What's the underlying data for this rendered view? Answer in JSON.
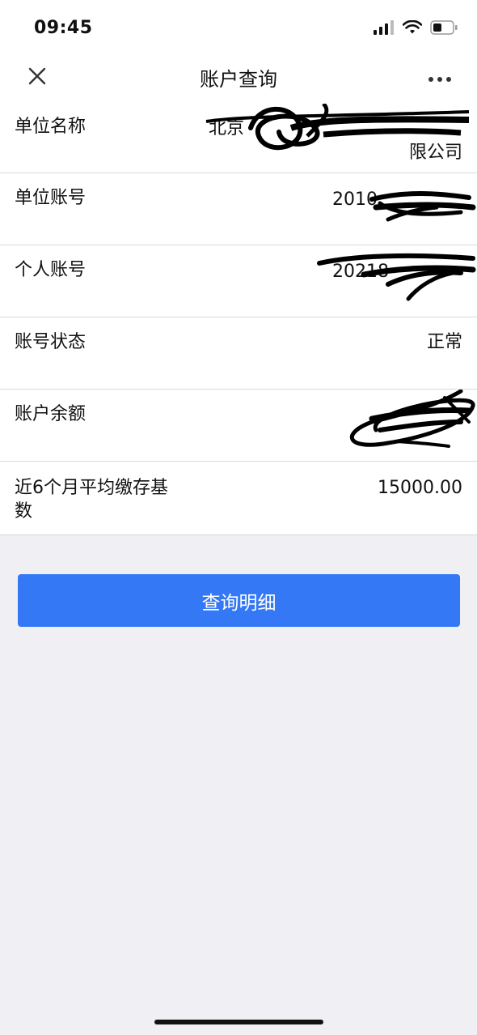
{
  "status_bar": {
    "time": "09:45"
  },
  "nav": {
    "title": "账户查询"
  },
  "rows": [
    {
      "label": "单位名称",
      "value_line1": "北京",
      "value_line2": "限公司"
    },
    {
      "label": "单位账号",
      "value": "2010"
    },
    {
      "label": "个人账号",
      "value": "20218"
    },
    {
      "label": "账号状态",
      "value": "正常"
    },
    {
      "label": "账户余额",
      "value": ""
    },
    {
      "label_line1": "近6个月平均缴存基",
      "label_line2": "数",
      "value": "15000.00"
    }
  ],
  "actions": {
    "query_details_label": "查询明细"
  },
  "colors": {
    "primary": "#3478f6",
    "background": "#efeff4",
    "card": "#ffffff",
    "divider": "#d9d9d9"
  }
}
